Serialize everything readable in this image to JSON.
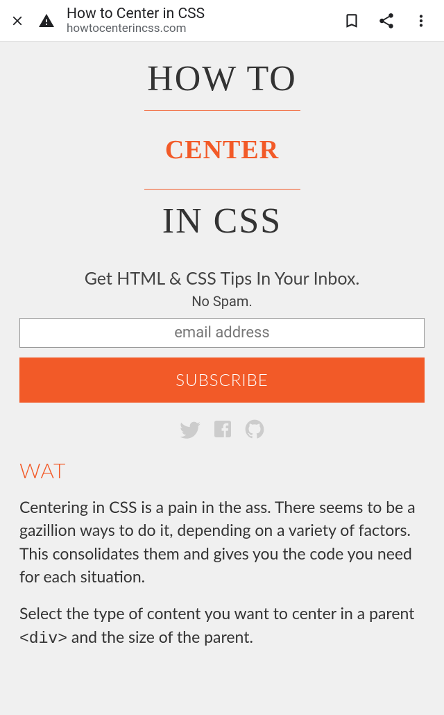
{
  "browser": {
    "title": "How to Center in CSS",
    "url": "howtocenterincss.com"
  },
  "hero": {
    "line1": "HOW TO",
    "line2": "CENTER",
    "line3": "IN CSS"
  },
  "subscribe": {
    "heading": "Get HTML & CSS Tips In Your Inbox.",
    "nospam": "No Spam.",
    "placeholder": "email address",
    "button": "SUBSCRIBE"
  },
  "section": {
    "heading": "WAT",
    "p1": "Centering in CSS is a pain in the ass. There seems to be a gazillion ways to do it, depending on a variety of factors. This consolidates them and gives you the code you need for each situation.",
    "p2a": "Select the type of content you want to center in a parent ",
    "p2code": "<div>",
    "p2b": " and the size of the parent."
  }
}
